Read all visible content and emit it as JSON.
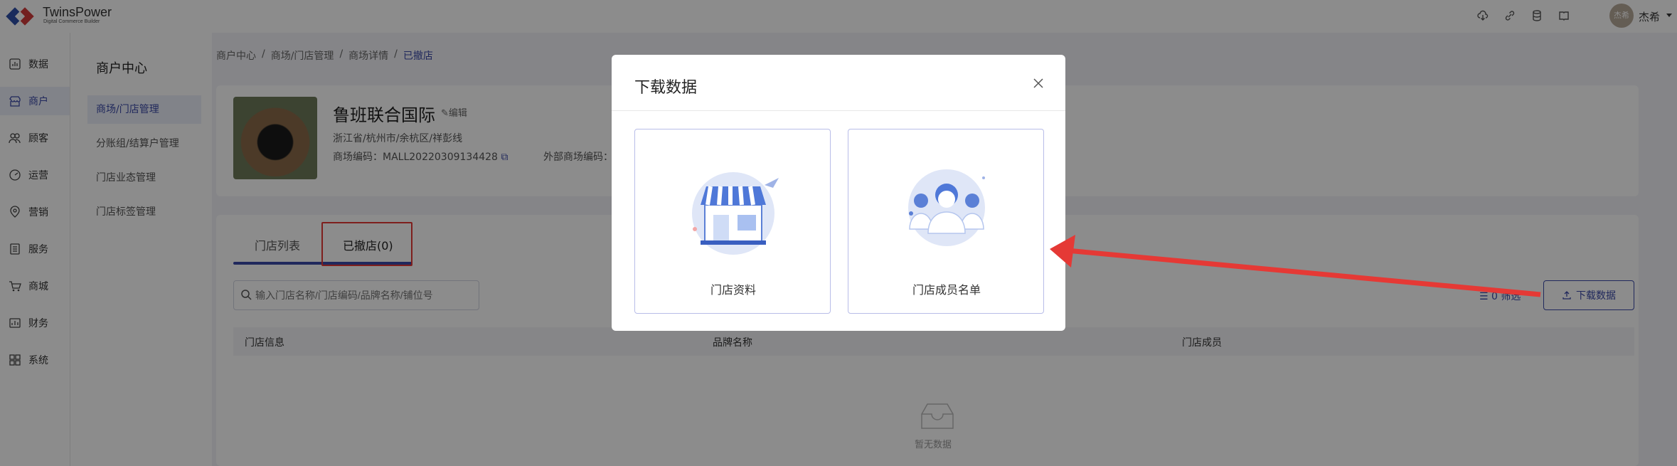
{
  "app": {
    "brand": "TwinsPower",
    "brand_sub": "Digital Commerce Builder"
  },
  "user": {
    "avatar_text": "杰希",
    "name": "杰希"
  },
  "leftnav": {
    "items": [
      {
        "label": "数据",
        "icon": "data-icon"
      },
      {
        "label": "商户",
        "icon": "store-icon"
      },
      {
        "label": "顾客",
        "icon": "customers-icon"
      },
      {
        "label": "运营",
        "icon": "operations-icon"
      },
      {
        "label": "营销",
        "icon": "marketing-icon"
      },
      {
        "label": "服务",
        "icon": "service-icon"
      },
      {
        "label": "商城",
        "icon": "cart-icon"
      },
      {
        "label": "财务",
        "icon": "finance-icon"
      },
      {
        "label": "系统",
        "icon": "system-icon"
      }
    ],
    "active_index": 1
  },
  "subnav": {
    "title": "商户中心",
    "items": [
      "商场/门店管理",
      "分账组/结算户管理",
      "门店业态管理",
      "门店标签管理"
    ],
    "active_index": 0
  },
  "breadcrumb": [
    "商户中心",
    "商场/门店管理",
    "商场详情",
    "已撤店"
  ],
  "mall": {
    "name": "鲁班联合国际",
    "edit_label": "编辑",
    "address": "浙江省/杭州市/余杭区/祥彭线",
    "code": "商场编码：MALL20220309134428",
    "external_code": "外部商场编码："
  },
  "tabs": [
    {
      "label": "门店列表"
    },
    {
      "label": "已撤店(0)"
    }
  ],
  "search": {
    "placeholder": "输入门店名称/门店编码/品牌名称/铺位号"
  },
  "filter_label": "0 筛选",
  "download_button": "下载数据",
  "table": {
    "headers": [
      "门店信息",
      "品牌名称",
      "门店成员"
    ],
    "empty_text": "暂无数据"
  },
  "modal": {
    "title": "下载数据",
    "options": [
      {
        "label": "门店资料"
      },
      {
        "label": "门店成员名单"
      }
    ]
  },
  "colors": {
    "accent": "#3b4aa8",
    "annotation": "#e53935"
  }
}
